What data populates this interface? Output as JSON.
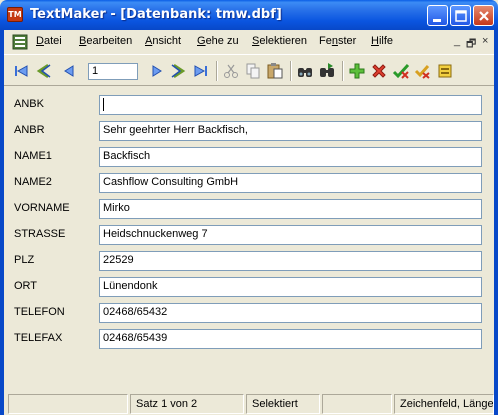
{
  "window": {
    "app_badge": "TM",
    "title": "TextMaker - [Datenbank: tmw.dbf]"
  },
  "menu": {
    "items": [
      {
        "pre": "",
        "u": "D",
        "post": "atei"
      },
      {
        "pre": "",
        "u": "B",
        "post": "earbeiten"
      },
      {
        "pre": "",
        "u": "A",
        "post": "nsicht"
      },
      {
        "pre": "",
        "u": "G",
        "post": "ehe zu"
      },
      {
        "pre": "",
        "u": "S",
        "post": "elektieren"
      },
      {
        "pre": "Fe",
        "u": "n",
        "post": "ster"
      },
      {
        "pre": "",
        "u": "H",
        "post": "ilfe"
      }
    ],
    "mdi_minimize": "_",
    "mdi_restore": "🗗",
    "mdi_close": "×"
  },
  "toolbar": {
    "record_number": "1"
  },
  "fields": [
    {
      "label": "ANBK",
      "value": ""
    },
    {
      "label": "ANBR",
      "value": "Sehr geehrter Herr Backfisch,"
    },
    {
      "label": "NAME1",
      "value": "Backfisch"
    },
    {
      "label": "NAME2",
      "value": "Cashflow Consulting GmbH"
    },
    {
      "label": "VORNAME",
      "value": "Mirko"
    },
    {
      "label": "STRASSE",
      "value": "Heidschnuckenweg 7"
    },
    {
      "label": "PLZ",
      "value": "22529"
    },
    {
      "label": "ORT",
      "value": "Lünendonk"
    },
    {
      "label": "TELEFON",
      "value": "02468/65432"
    },
    {
      "label": "TELEFAX",
      "value": "02468/65439"
    }
  ],
  "status": {
    "record": "Satz 1 von 2",
    "mode": "Selektiert",
    "field_type": "Zeichenfeld, Länge"
  },
  "colors": {
    "titlebar": "#0a55e0",
    "face": "#ece9d8",
    "input_border": "#7f9db9"
  }
}
